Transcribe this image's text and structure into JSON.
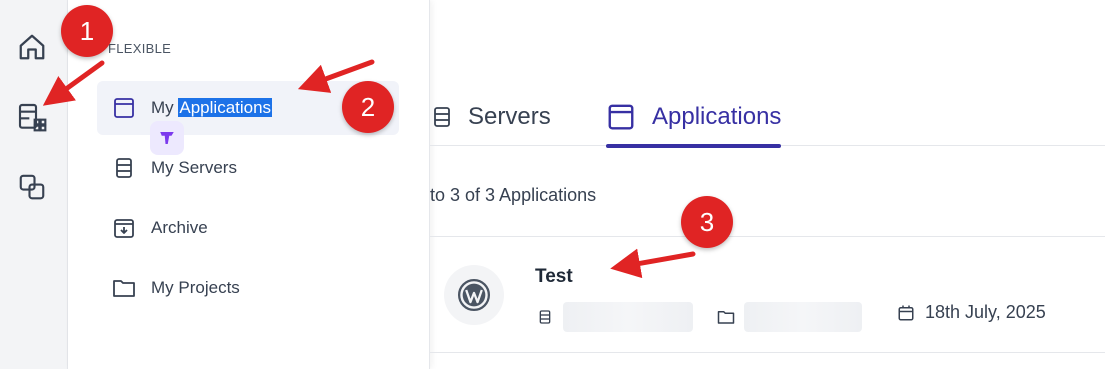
{
  "rail": {
    "items": [
      {
        "icon": "home-icon"
      },
      {
        "icon": "applications-grid-icon"
      },
      {
        "icon": "integrations-icon"
      }
    ]
  },
  "flyout": {
    "section_label": "FLEXIBLE",
    "items": [
      {
        "label_prefix": "My ",
        "label_highlight": "Applications",
        "icon": "application-window-icon",
        "active": true
      },
      {
        "label": "My Servers",
        "icon": "server-icon"
      },
      {
        "label": "Archive",
        "icon": "archive-icon"
      },
      {
        "label": "My Projects",
        "icon": "folder-icon"
      }
    ]
  },
  "tabs": [
    {
      "label": "Servers",
      "icon": "server-icon"
    },
    {
      "label": "Applications",
      "icon": "application-window-icon",
      "active": true
    }
  ],
  "list": {
    "count_text": "to 3 of 3 Applications",
    "apps": [
      {
        "name": "Test",
        "date": "18th July, 2025",
        "avatar_icon": "wordpress-icon"
      }
    ]
  },
  "annotations": {
    "markers": [
      "1",
      "2",
      "3"
    ]
  },
  "colors": {
    "accent": "#3730a3",
    "marker": "#e02424",
    "selection": "#1d72e8"
  }
}
